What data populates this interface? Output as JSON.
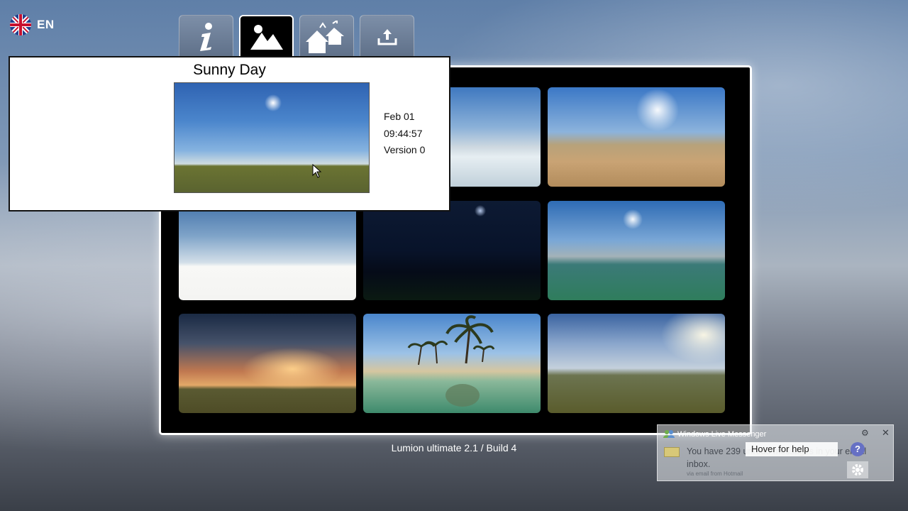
{
  "language": {
    "code": "EN",
    "flag_icon": "uk-flag-icon"
  },
  "tabs": [
    {
      "name": "info",
      "icon": "info-icon",
      "active": false
    },
    {
      "name": "sky",
      "icon": "landscape-icon",
      "active": true
    },
    {
      "name": "houses",
      "icon": "houses-icon",
      "active": false
    },
    {
      "name": "upload",
      "icon": "upload-icon",
      "active": false
    }
  ],
  "popup": {
    "title": "Sunny Day",
    "date": "Feb 01",
    "time": "09:44:57",
    "version": "Version 0"
  },
  "thumbnails": [
    {
      "id": "ice-landscape"
    },
    {
      "id": "desert-landscape"
    },
    {
      "id": "white-plain"
    },
    {
      "id": "night-sky"
    },
    {
      "id": "lake-landscape"
    },
    {
      "id": "sunset-landscape"
    },
    {
      "id": "tropical-beach"
    },
    {
      "id": "cloudy-plain"
    }
  ],
  "footer": {
    "version_text": "Lumion ultimate  2.1 / Build 4"
  },
  "messenger": {
    "title": "Windows Live Messenger",
    "message": "You have 239 unread messages in your email inbox.",
    "via": "via email from Hotmail",
    "help_text": "Hover for help",
    "help_glyph": "?",
    "close_glyph": "✕",
    "gear_glyph": "⚙"
  },
  "colors": {
    "library_bg": "#000000",
    "active_tab_border": "#ffffff",
    "accent_help": "#6670c4"
  }
}
